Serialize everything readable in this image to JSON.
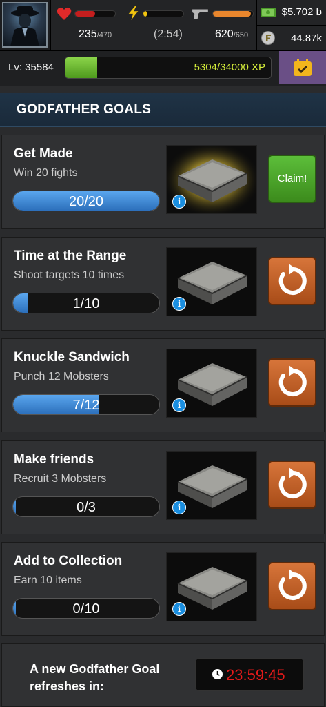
{
  "hud": {
    "health": {
      "current": "235",
      "max": "/470",
      "fraction": 0.5
    },
    "energy": {
      "timer": "(2:54)",
      "fraction": 0.08
    },
    "ammo": {
      "current": "620",
      "max": "/650",
      "fraction": 0.95
    },
    "cash": "$5.702 b",
    "favor": "44.87k"
  },
  "level": {
    "label": "Lv: 35584",
    "xp_text": "5304/34000 XP",
    "xp_fraction": 0.156
  },
  "header": {
    "title": "GODFATHER GOALS"
  },
  "goals": [
    {
      "title": "Get Made",
      "desc": "Win 20 fights",
      "progress": "20/20",
      "fraction": 1.0,
      "action": "claim",
      "action_label": "Claim!",
      "glow": true
    },
    {
      "title": "Time at the Range",
      "desc": "Shoot targets 10 times",
      "progress": "1/10",
      "fraction": 0.1,
      "action": "refresh",
      "glow": false
    },
    {
      "title": "Knuckle Sandwich",
      "desc": "Punch 12 Mobsters",
      "progress": "7/12",
      "fraction": 0.583,
      "action": "refresh",
      "glow": false
    },
    {
      "title": "Make friends",
      "desc": "Recruit 3 Mobsters",
      "progress": "0/3",
      "fraction": 0.02,
      "action": "refresh",
      "glow": false
    },
    {
      "title": "Add to Collection",
      "desc": "Earn 10 items",
      "progress": "0/10",
      "fraction": 0.02,
      "action": "refresh",
      "glow": false
    }
  ],
  "info_glyph": "i",
  "footer": {
    "text": "A new Godfather Goal refreshes in:",
    "timer": "23:59:45"
  },
  "colors": {
    "health": "#d62828",
    "energy": "#f1c40f",
    "ammo": "#e8862d",
    "xp": "#6bb431",
    "timer": "#e51a1a"
  },
  "icons": [
    "avatar-icon",
    "heart-icon",
    "lightning-icon",
    "gun-icon",
    "cash-icon",
    "favor-coin-icon",
    "calendar-check-icon",
    "crate-icon",
    "info-icon",
    "refresh-icon",
    "clock-icon"
  ]
}
